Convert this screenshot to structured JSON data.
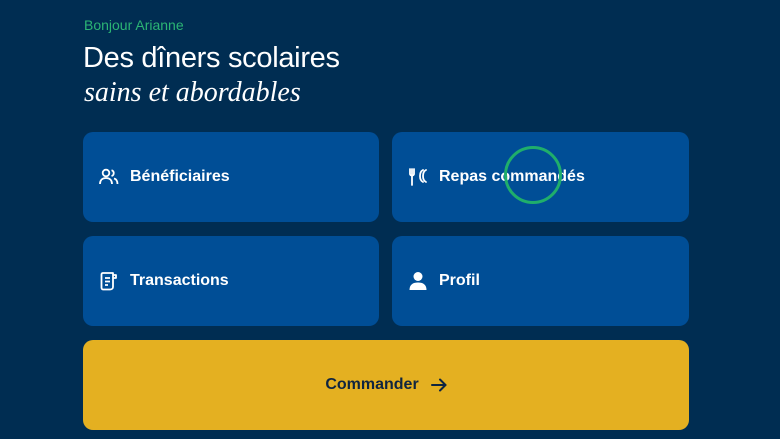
{
  "header": {
    "greeting": "Bonjour Arianne",
    "title_line1": "Des dîners scolaires",
    "title_line2": "sains et abordables"
  },
  "cards": [
    {
      "label": "Bénéficiaires",
      "icon": "users-icon"
    },
    {
      "label": "Repas commandés",
      "icon": "utensils-icon"
    },
    {
      "label": "Transactions",
      "icon": "receipt-icon"
    },
    {
      "label": "Profil",
      "icon": "user-icon"
    }
  ],
  "order_button": {
    "label": "Commander",
    "icon": "arrow-right-icon"
  },
  "colors": {
    "background": "#002d52",
    "card": "#004e96",
    "accent_green": "#2bb574",
    "order_button": "#e4b021",
    "order_text": "#0f2540"
  }
}
